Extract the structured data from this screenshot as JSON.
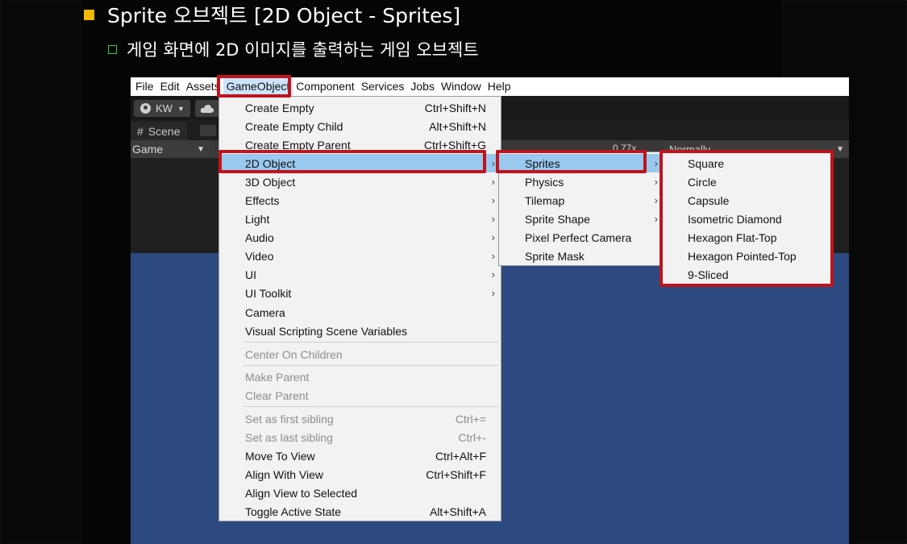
{
  "slide": {
    "title": "Sprite 오브젝트 [2D Object - Sprites]",
    "subtitle": "게임 화면에 2D 이미지를 출력하는 게임 오브젝트"
  },
  "menubar": [
    "File",
    "Edit",
    "Assets",
    "GameObject",
    "Component",
    "Services",
    "Jobs",
    "Window",
    "Help"
  ],
  "toolbar": {
    "account": "KW"
  },
  "tabs": {
    "scene": "Scene"
  },
  "gamebar": {
    "display": "Game",
    "zoom": "0.77x",
    "mode": "Normally"
  },
  "gameobject_menu": {
    "items": [
      {
        "label": "Create Empty",
        "shortcut": "Ctrl+Shift+N"
      },
      {
        "label": "Create Empty Child",
        "shortcut": "Alt+Shift+N"
      },
      {
        "label": "Create Empty Parent",
        "shortcut": "Ctrl+Shift+G"
      },
      {
        "label": "2D Object",
        "submenu": true
      },
      {
        "label": "3D Object",
        "submenu": true
      },
      {
        "label": "Effects",
        "submenu": true
      },
      {
        "label": "Light",
        "submenu": true
      },
      {
        "label": "Audio",
        "submenu": true
      },
      {
        "label": "Video",
        "submenu": true
      },
      {
        "label": "UI",
        "submenu": true
      },
      {
        "label": "UI Toolkit",
        "submenu": true
      },
      {
        "label": "Camera"
      },
      {
        "label": "Visual Scripting Scene Variables"
      },
      {
        "label": "Center On Children",
        "disabled": true
      },
      {
        "label": "Make Parent",
        "disabled": true
      },
      {
        "label": "Clear Parent",
        "disabled": true
      },
      {
        "label": "Set as first sibling",
        "shortcut": "Ctrl+=",
        "disabled": true
      },
      {
        "label": "Set as last sibling",
        "shortcut": "Ctrl+-",
        "disabled": true
      },
      {
        "label": "Move To View",
        "shortcut": "Ctrl+Alt+F"
      },
      {
        "label": "Align With View",
        "shortcut": "Ctrl+Shift+F"
      },
      {
        "label": "Align View to Selected"
      },
      {
        "label": "Toggle Active State",
        "shortcut": "Alt+Shift+A"
      }
    ]
  },
  "object2d_menu": {
    "items": [
      {
        "label": "Sprites",
        "submenu": true
      },
      {
        "label": "Physics",
        "submenu": true
      },
      {
        "label": "Tilemap",
        "submenu": true
      },
      {
        "label": "Sprite Shape",
        "submenu": true
      },
      {
        "label": "Pixel Perfect Camera"
      },
      {
        "label": "Sprite Mask"
      }
    ]
  },
  "sprites_menu": {
    "items": [
      {
        "label": "Square"
      },
      {
        "label": "Circle"
      },
      {
        "label": "Capsule"
      },
      {
        "label": "Isometric Diamond"
      },
      {
        "label": "Hexagon Flat-Top"
      },
      {
        "label": "Hexagon Pointed-Top"
      },
      {
        "label": "9-Sliced"
      }
    ]
  },
  "colors": {
    "highlight": "#99c9ef",
    "callout_border": "#c0141c",
    "game_view": "#2c4a80",
    "title_bullet": "#f5b800",
    "sub_bullet": "#2fd04a"
  }
}
